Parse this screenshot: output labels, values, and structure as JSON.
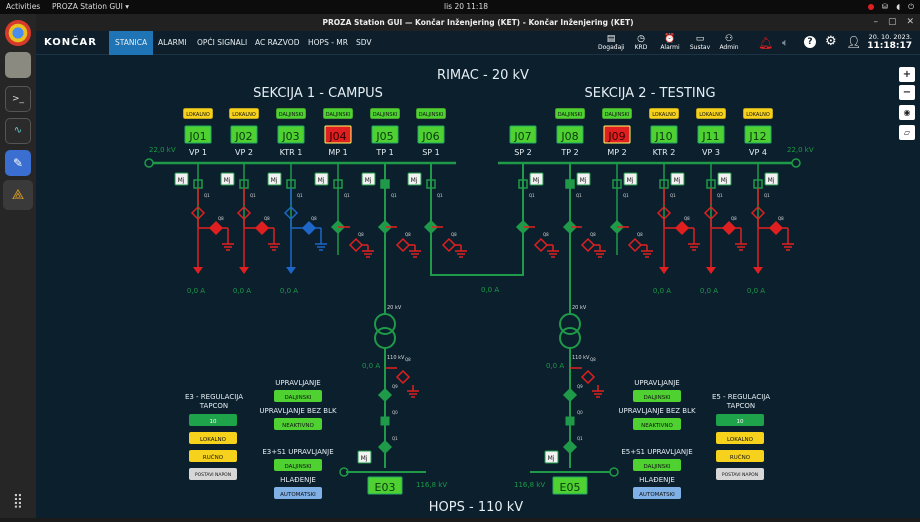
{
  "topbar": {
    "activities": "Activities",
    "app": "PROZA Station GUI ▾",
    "clock": "lis 20  11:18"
  },
  "window": {
    "title": "PROZA Station GUI — Končar Inženjering (KET) - Končar Inženjering (KET)"
  },
  "nav": {
    "logo": "KONČAR",
    "tabs": [
      "STANICA",
      "ALARMI",
      "OPĆI SIGNALI",
      "AC RAZVOD",
      "HOPS - MR",
      "SDV"
    ],
    "icons": [
      {
        "name": "Događaji",
        "icon": "doc-icon"
      },
      {
        "name": "KRD",
        "icon": "clock-icon"
      },
      {
        "name": "Alarmi",
        "icon": "alarm-clock-icon"
      },
      {
        "name": "Sustav",
        "icon": "screen-icon"
      },
      {
        "name": "Admin",
        "icon": "user-icon"
      }
    ],
    "date": "20. 10. 2023.",
    "time": "11:18:17"
  },
  "colors": {
    "line": "#1e9a48",
    "red": "#e02020",
    "blue": "#1e66c8",
    "yellow": "#f6d21c",
    "green": "#4fd132",
    "bg": "#0b1f2d"
  },
  "diagram": {
    "title_top": "RIMAC - 20 kV",
    "title_bottom": "HOPS - 110 kV",
    "sec1": "SEKCIJA 1 - CAMPUS",
    "sec2": "SEKCIJA 2 - TESTING",
    "bus_kv": "22,0 kV",
    "lokalno": "LOKALNO",
    "daljinski": "DALJINSKI",
    "mj": "Mj",
    "q1": "Q1",
    "q8": "Q8",
    "q0": "Q0",
    "q9": "Q9",
    "kv20": "20 kV",
    "kv110": "110 kV",
    "current": "0,0 A",
    "hv_kv": "116,8 kV",
    "feeders": [
      {
        "id": "J01",
        "name": "VP 1",
        "mode": "LOKALNO",
        "state": "open",
        "alarm": false,
        "current": "0,0 A"
      },
      {
        "id": "J02",
        "name": "VP 2",
        "mode": "LOKALNO",
        "state": "open",
        "alarm": false,
        "current": "0,0 A"
      },
      {
        "id": "J03",
        "name": "KTR 1",
        "mode": "DALJINSKI",
        "state": "blue",
        "alarm": false,
        "current": "0,0 A"
      },
      {
        "id": "J04",
        "name": "MP 1",
        "mode": "DALJINSKI",
        "state": "mp",
        "alarm": true,
        "current": ""
      },
      {
        "id": "J05",
        "name": "TP 1",
        "mode": "DALJINSKI",
        "state": "tp",
        "alarm": false,
        "current": ""
      },
      {
        "id": "J06",
        "name": "SP 1",
        "mode": "DALJINSKI",
        "state": "sp",
        "alarm": false,
        "current": ""
      },
      {
        "id": "J07",
        "name": "SP 2",
        "mode": "",
        "state": "sp2",
        "alarm": false,
        "current": ""
      },
      {
        "id": "J08",
        "name": "TP 2",
        "mode": "DALJINSKI",
        "state": "tp",
        "alarm": false,
        "current": ""
      },
      {
        "id": "J09",
        "name": "MP 2",
        "mode": "DALJINSKI",
        "state": "mp",
        "alarm": true,
        "current": ""
      },
      {
        "id": "J10",
        "name": "KTR 2",
        "mode": "LOKALNO",
        "state": "open",
        "alarm": false,
        "current": "0,0 A"
      },
      {
        "id": "J11",
        "name": "VP 3",
        "mode": "LOKALNO",
        "state": "open",
        "alarm": false,
        "current": "0,0 A"
      },
      {
        "id": "J12",
        "name": "VP 4",
        "mode": "LOKALNO",
        "state": "open",
        "alarm": false,
        "current": "0,0 A"
      }
    ],
    "left_panel": {
      "title": "E3 - REGULACIJA TAPCON",
      "value": "10",
      "lokalno": "LOKALNO",
      "rucno": "RUČNO",
      "postavi": "POSTAVI NAPON",
      "upr": "UPRAVLJANJE",
      "upr_btn": "DALJINSKI",
      "blk": "UPRAVLJANJE BEZ BLK",
      "blk_btn": "NEAKTIVNO",
      "s1": "E3+S1 UPRAVLJANJE",
      "s1_btn": "DALJINSKI",
      "hl": "HLAĐENJE",
      "hl_btn": "AUTOMATSKI",
      "bay": "E03"
    },
    "right_panel": {
      "title": "E5 - REGULACIJA TAPCON",
      "value": "10",
      "lokalno": "LOKALNO",
      "rucno": "RUČNO",
      "postavi": "POSTAVI NAPON",
      "upr": "UPRAVLJANJE",
      "upr_btn": "DALJINSKI",
      "blk": "UPRAVLJANJE BEZ BLK",
      "blk_btn": "NEAKTIVNO",
      "s1": "E5+S1 UPRAVLJANJE",
      "s1_btn": "DALJINSKI",
      "hl": "HLAĐENJE",
      "hl_btn": "AUTOMATSKI",
      "bay": "E05"
    }
  }
}
